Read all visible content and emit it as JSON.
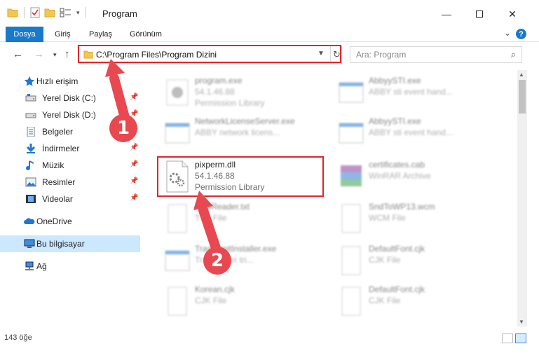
{
  "window": {
    "title": "Program",
    "minimize_icon": "minimize-icon",
    "maximize_icon": "maximize-icon",
    "close_icon": "close-icon"
  },
  "ribbon": {
    "tabs": [
      {
        "label": "Dosya",
        "active": true
      },
      {
        "label": "Giriş"
      },
      {
        "label": "Paylaş"
      },
      {
        "label": "Görünüm"
      }
    ],
    "help_label": "?"
  },
  "address_bar": {
    "path": "C:\\Program Files\\Program Dizini"
  },
  "search": {
    "placeholder": "Ara: Program"
  },
  "sidebar": {
    "items": [
      {
        "label": "Hızlı erişim",
        "icon": "star-icon"
      },
      {
        "label": "Yerel Disk (C:)",
        "icon": "drive-icon",
        "pinned": true
      },
      {
        "label": "Yerel Disk (D:)",
        "icon": "drive-icon",
        "pinned": true
      },
      {
        "label": "Belgeler",
        "icon": "documents-icon",
        "pinned": true
      },
      {
        "label": "İndirmeler",
        "icon": "download-icon",
        "pinned": true
      },
      {
        "label": "Müzik",
        "icon": "music-icon",
        "pinned": true
      },
      {
        "label": "Resimler",
        "icon": "pictures-icon",
        "pinned": true
      },
      {
        "label": "Videolar",
        "icon": "video-icon",
        "pinned": true
      },
      {
        "label": "OneDrive",
        "icon": "cloud-icon"
      },
      {
        "label": "Bu bilgisayar",
        "icon": "computer-icon",
        "selected": true
      },
      {
        "label": "Ağ",
        "icon": "network-icon"
      }
    ]
  },
  "files": {
    "col1": [
      {
        "name": "program.exe",
        "line1": "54.1.46.88",
        "line2": "Permission Library",
        "blurred": true
      },
      {
        "name": "NetworkLicenseServer.exe",
        "line1": "ABBY network licens...",
        "line2": "",
        "blurred": true
      },
      {
        "name": "pixperm.dll",
        "line1": "54.1.46.88",
        "line2": "Permission Library",
        "blurred": false
      },
      {
        "name": "FineReader.txt",
        "line1": "TXT File",
        "line2": "",
        "blurred": true
      },
      {
        "name": "TrasnsmitInstaller.exe",
        "line1": "Transmitter tri...",
        "line2": "",
        "blurred": true
      },
      {
        "name": "Korean.cjk",
        "line1": "CJK File",
        "line2": "",
        "blurred": true
      }
    ],
    "col2": [
      {
        "name": "AbbyySTI.exe",
        "line1": "ABBY sti event hand...",
        "blurred": true
      },
      {
        "name": "AbbyySTI.exe",
        "line1": "ABBY sti event hand...",
        "blurred": true
      },
      {
        "name": "certificates.cab",
        "line1": "WinRAR Archive",
        "blurred": true
      },
      {
        "name": "SndToWP13.wcm",
        "line1": "WCM File",
        "blurred": true
      },
      {
        "name": "DefaultFont.cjk",
        "line1": "CJK File",
        "blurred": true
      },
      {
        "name": "DefaultFont.cjk",
        "line1": "CJK File",
        "blurred": true
      }
    ]
  },
  "status": {
    "item_count": "143 öğe"
  },
  "callouts": [
    {
      "number": "1"
    },
    {
      "number": "2"
    }
  ],
  "colors": {
    "accent": "#1979ca",
    "highlight": "#e0262a",
    "callout": "#e8484f",
    "selected": "#cce8ff"
  }
}
